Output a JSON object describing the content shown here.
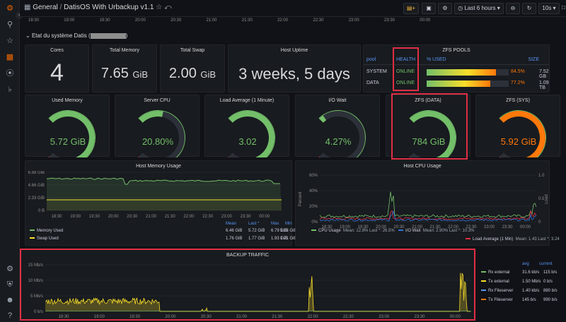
{
  "topbar": {
    "breadcrumb_root": "General",
    "breadcrumb_sep": "/",
    "dashboard_title": "DatisOS With Urbackup v1.1",
    "time_range": "Last 6 hours",
    "refresh": "10s"
  },
  "time_ticks": [
    "18:30",
    "19:00",
    "19:30",
    "20:00",
    "20:30",
    "21:00",
    "21:30",
    "22:00",
    "22:30",
    "23:00",
    "23:30",
    "00:00"
  ],
  "row_title": "Etat du système Datis (",
  "row_title_end": ")",
  "stats": {
    "cores": {
      "title": "Cores",
      "value": "4"
    },
    "total_memory": {
      "title": "Total Memory",
      "value": "7.65",
      "unit": "GiB"
    },
    "total_swap": {
      "title": "Total Swap",
      "value": "2.00",
      "unit": "GiB"
    },
    "uptime": {
      "title": "Host Uptime",
      "value": "3 weeks, 5 days"
    }
  },
  "zfs": {
    "title": "ZFS POOLS",
    "headers": [
      "pool",
      "HEALTH",
      "% USED",
      "SIZE"
    ],
    "rows": [
      {
        "pool": "SYSTEM",
        "health": "ONLINE",
        "pct_label": "84.5%",
        "pct": 84.5,
        "size": "7.52 GB"
      },
      {
        "pool": "DATA",
        "health": "ONLINE",
        "pct_label": "77.2%",
        "pct": 77.2,
        "size": "1.09 TB"
      }
    ]
  },
  "gauges": [
    {
      "title": "Used Memory",
      "value": "5.72 GiB",
      "level": 0.75,
      "color": "#73bf69"
    },
    {
      "title": "Server CPU",
      "value": "20.80%",
      "level": 0.21,
      "color": "#73bf69"
    },
    {
      "title": "Load Average (1 Minute)",
      "value": "3.02",
      "level": 0.75,
      "color": "#73bf69"
    },
    {
      "title": "I/O Wait",
      "value": "4.27%",
      "level": 0.04,
      "color": "#73bf69"
    },
    {
      "title": "ZFS (DATA)",
      "value": "784 GiB",
      "level": 0.77,
      "color": "#73bf69"
    },
    {
      "title": "ZFS (SYS)",
      "value": "5.92 GiB",
      "level": 0.85,
      "color": "#ff780a"
    }
  ],
  "memory_panel": {
    "title": "Host Memory Usage",
    "y_ticks": [
      "6.98 GiB",
      "4.66 GiB",
      "2.33 GiB",
      "0 B"
    ],
    "legend_headers": [
      "Mean",
      "Last *",
      "Max",
      "Min"
    ],
    "legend": [
      {
        "name": "Memory Used",
        "color": "#73bf69",
        "mean": "6.46 GiB",
        "last": "5.72 GiB",
        "max": "6.79 GiB",
        "min": "5.13 GiB"
      },
      {
        "name": "Swap Used",
        "color": "#fade2a",
        "mean": "1.76 GiB",
        "last": "1.77 GiB",
        "max": "1.93 GiB",
        "min": "1.71 GiB"
      }
    ]
  },
  "cpu_panel": {
    "title": "Host CPU Usage",
    "y_left_label": "Percent",
    "y_right_label": "Load",
    "y_left_ticks": [
      "60%",
      "40%",
      "20%",
      "0%"
    ],
    "y_right_ticks": [
      "1.0",
      "0.5",
      "0"
    ],
    "legend": [
      {
        "name": "CPU Usage",
        "color": "#73bf69",
        "stats": "Mean: 12.8%   Last *: 26.5%"
      },
      {
        "name": "I/O Wait",
        "color": "#3274d9",
        "stats": "Mean: 2.90%   Last *: 10.3%"
      },
      {
        "name": "Load Average (1 Min)",
        "color": "#e02f44",
        "stats": "Mean: 1.43   Last *: 3.24"
      }
    ]
  },
  "backup_panel": {
    "title": "BACKUP TRAFFIC",
    "y_ticks": [
      "15 Mb/s",
      "10 Mb/s",
      "5 Mb/s",
      "0 b/s"
    ],
    "legend_headers": [
      "avg",
      "current"
    ],
    "legend": [
      {
        "name": "Rx external",
        "color": "#73bf69",
        "avg": "31.6 kb/s",
        "current": "115 b/s"
      },
      {
        "name": "Tx external",
        "color": "#fade2a",
        "avg": "1.50 Mb/s",
        "current": "0 b/s"
      },
      {
        "name": "Rx Fileserver",
        "color": "#5794f2",
        "avg": "1.40 kb/s",
        "current": "880 b/s"
      },
      {
        "name": "Tx Fileserver",
        "color": "#ff780a",
        "avg": "145 b/s",
        "current": "990 b/s"
      }
    ]
  }
}
